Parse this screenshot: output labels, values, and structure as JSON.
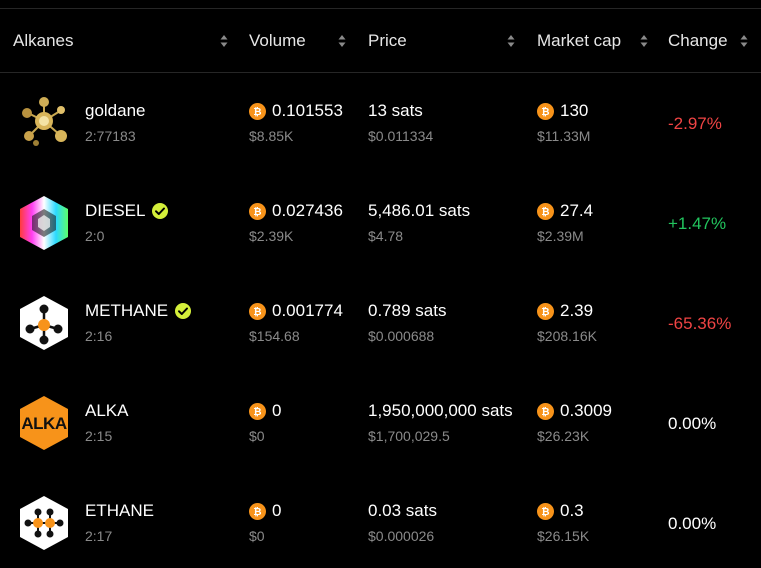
{
  "columns": {
    "alkanes": "Alkanes",
    "volume": "Volume",
    "price": "Price",
    "market_cap": "Market cap",
    "change": "Change"
  },
  "rows": [
    {
      "name": "goldane",
      "id": "2:77183",
      "verified": false,
      "volume_btc": "0.101553",
      "volume_usd": "$8.85K",
      "price": "13 sats",
      "price_usd": "$0.011334",
      "mcap_btc": "130",
      "mcap_usd": "$11.33M",
      "change": "-2.97%",
      "change_dir": "neg",
      "logo": "goldane-molecule-icon"
    },
    {
      "name": "DIESEL",
      "id": "2:0",
      "verified": true,
      "volume_btc": "0.027436",
      "volume_usd": "$2.39K",
      "price": "5,486.01 sats",
      "price_usd": "$4.78",
      "mcap_btc": "27.4",
      "mcap_usd": "$2.39M",
      "change": "+1.47%",
      "change_dir": "pos",
      "logo": "diesel-rainbow-hexagon-icon"
    },
    {
      "name": "METHANE",
      "id": "2:16",
      "verified": true,
      "volume_btc": "0.001774",
      "volume_usd": "$154.68",
      "price": "0.789 sats",
      "price_usd": "$0.000688",
      "mcap_btc": "2.39",
      "mcap_usd": "$208.16K",
      "change": "-65.36%",
      "change_dir": "neg",
      "logo": "methane-molecule-hexagon-icon"
    },
    {
      "name": "ALKA",
      "id": "2:15",
      "verified": false,
      "volume_btc": "0",
      "volume_usd": "$0",
      "price": "1,950,000,000 sats",
      "price_usd": "$1,700,029.5",
      "mcap_btc": "0.3009",
      "mcap_usd": "$26.23K",
      "change": "0.00%",
      "change_dir": "neutral",
      "logo": "alka-orange-hexagon-icon",
      "logo_text": "ALKA"
    },
    {
      "name": "ETHANE",
      "id": "2:17",
      "verified": false,
      "volume_btc": "0",
      "volume_usd": "$0",
      "price": "0.03 sats",
      "price_usd": "$0.000026",
      "mcap_btc": "0.3",
      "mcap_usd": "$26.15K",
      "change": "0.00%",
      "change_dir": "neutral",
      "logo": "ethane-molecule-hexagon-icon"
    }
  ],
  "colors": {
    "bitcoin": "#f7931a",
    "negative": "#ef4444",
    "positive": "#22c55e",
    "verified": "#d4ef3a",
    "muted": "#8a8a8a"
  },
  "icons": {
    "sort": "sort-updown-icon",
    "bitcoin": "bitcoin-icon",
    "verified": "verified-check-icon"
  }
}
